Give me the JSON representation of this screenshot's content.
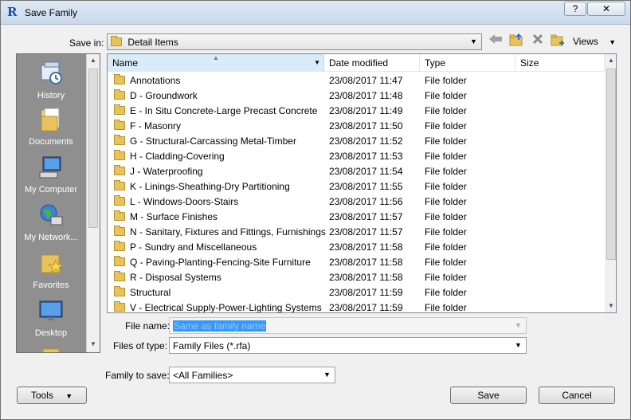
{
  "window": {
    "title": "Save Family",
    "app_icon": "R",
    "help_label": "?",
    "close_label": "✕"
  },
  "save_in": {
    "label": "Save in:",
    "value": "Detail Items"
  },
  "toolbar": {
    "back_icon": "back-arrow-icon",
    "up_folder_icon": "up-folder-icon",
    "delete_icon": "delete-icon",
    "new_folder_icon": "new-folder-icon",
    "views_label": "Views"
  },
  "places": [
    {
      "label": "History",
      "icon": "history-icon"
    },
    {
      "label": "Documents",
      "icon": "documents-icon"
    },
    {
      "label": "My Computer",
      "icon": "computer-icon"
    },
    {
      "label": "My Network...",
      "icon": "network-icon"
    },
    {
      "label": "Favorites",
      "icon": "favorites-icon"
    },
    {
      "label": "Desktop",
      "icon": "desktop-icon"
    }
  ],
  "columns": [
    "Name",
    "Date modified",
    "Type",
    "Size"
  ],
  "files": [
    {
      "name": "Annotations",
      "date": "23/08/2017 11:47",
      "type": "File folder"
    },
    {
      "name": "D - Groundwork",
      "date": "23/08/2017 11:48",
      "type": "File folder"
    },
    {
      "name": "E - In Situ Concrete-Large Precast Concrete",
      "date": "23/08/2017 11:49",
      "type": "File folder"
    },
    {
      "name": "F - Masonry",
      "date": "23/08/2017 11:50",
      "type": "File folder"
    },
    {
      "name": "G - Structural-Carcassing Metal-Timber",
      "date": "23/08/2017 11:52",
      "type": "File folder"
    },
    {
      "name": "H - Cladding-Covering",
      "date": "23/08/2017 11:53",
      "type": "File folder"
    },
    {
      "name": "J - Waterproofing",
      "date": "23/08/2017 11:54",
      "type": "File folder"
    },
    {
      "name": "K - Linings-Sheathing-Dry Partitioning",
      "date": "23/08/2017 11:55",
      "type": "File folder"
    },
    {
      "name": "L - Windows-Doors-Stairs",
      "date": "23/08/2017 11:56",
      "type": "File folder"
    },
    {
      "name": "M - Surface Finishes",
      "date": "23/08/2017 11:57",
      "type": "File folder"
    },
    {
      "name": "N - Sanitary, Fixtures and Fittings, Furnishings",
      "date": "23/08/2017 11:57",
      "type": "File folder"
    },
    {
      "name": "P - Sundry and Miscellaneous",
      "date": "23/08/2017 11:58",
      "type": "File folder"
    },
    {
      "name": "Q - Paving-Planting-Fencing-Site Furniture",
      "date": "23/08/2017 11:58",
      "type": "File folder"
    },
    {
      "name": "R - Disposal Systems",
      "date": "23/08/2017 11:58",
      "type": "File folder"
    },
    {
      "name": "Structural",
      "date": "23/08/2017 11:59",
      "type": "File folder"
    },
    {
      "name": "V - Electrical Supply-Power-Lighting Systems",
      "date": "23/08/2017 11:59",
      "type": "File folder"
    }
  ],
  "file_name": {
    "label": "File name:",
    "placeholder": "Same as family name"
  },
  "files_of_type": {
    "label": "Files of type:",
    "value": "Family Files  (*.rfa)"
  },
  "family_to_save": {
    "label": "Family to save:",
    "value": "<All Families>"
  },
  "buttons": {
    "tools": "Tools",
    "save": "Save",
    "cancel": "Cancel"
  }
}
